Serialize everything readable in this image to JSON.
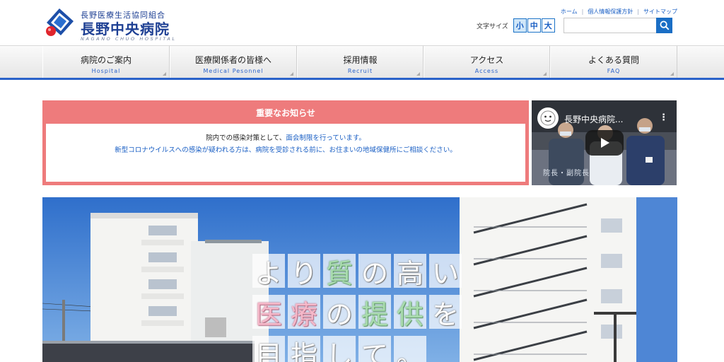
{
  "header": {
    "org_name": "長野医療生活協同組合",
    "hospital_name": "長野中央病院",
    "hospital_roman": "NAGANO CHUO HOSPITAL",
    "links": [
      {
        "label": "ホーム"
      },
      {
        "label": "個人情報保護方針"
      },
      {
        "label": "サイトマップ"
      }
    ],
    "font_size": {
      "label": "文字サイズ",
      "small": "小",
      "medium": "中",
      "large": "大",
      "selected": "小"
    },
    "search": {
      "value": "",
      "placeholder": ""
    }
  },
  "nav": {
    "items": [
      {
        "label": "病院のご案内",
        "sub": "Hospital"
      },
      {
        "label": "医療関係者の皆様へ",
        "sub": "Medical Pesonnel"
      },
      {
        "label": "採用情報",
        "sub": "Recruit"
      },
      {
        "label": "アクセス",
        "sub": "Access"
      },
      {
        "label": "よくある質問",
        "sub": "FAQ"
      }
    ]
  },
  "notice": {
    "title": "重要なお知らせ",
    "line1_prefix": "院内での感染対策として、",
    "line1_link": "面会制限を行っています。",
    "line2": "新型コロナウイルスへの感染が疑われる方は、病院を受診される前に、お住まいの地域保健所にご相談ください。"
  },
  "video": {
    "title": "長野中央病院...",
    "caption": "院長・副院長",
    "menu": "⋮"
  },
  "hero": {
    "line1": "より質の高い",
    "line2": "医療の提供を",
    "line3": "目指して。"
  },
  "colors": {
    "brand_blue": "#1d3f93",
    "link_blue": "#1a5fc4",
    "notice_pink": "#ee7b7c",
    "nav_underline": "#2a62c9"
  },
  "icons": {
    "search": "search-icon",
    "logo": "logo-mark-icon",
    "play": "play-icon"
  }
}
